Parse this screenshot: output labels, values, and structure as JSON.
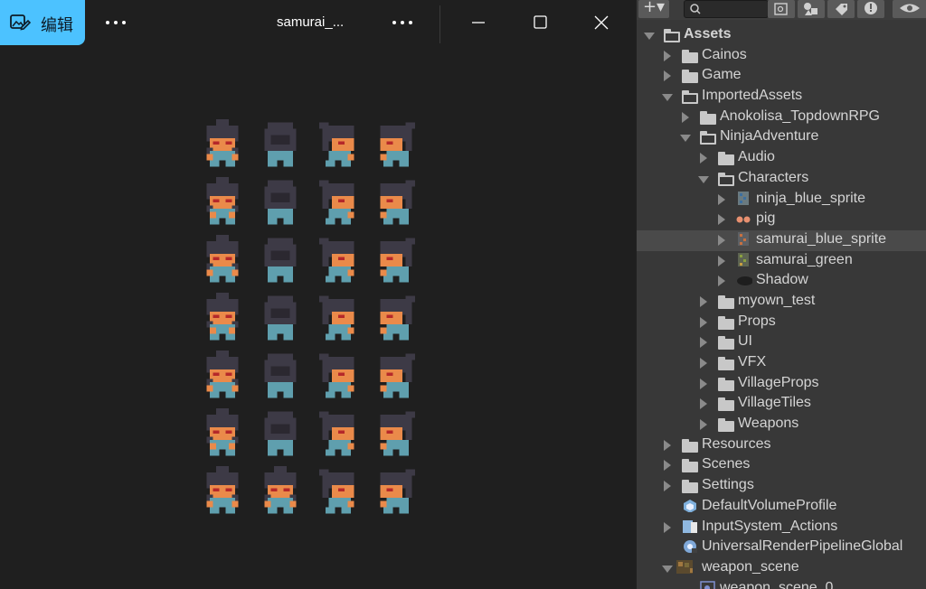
{
  "viewer": {
    "edit_label": "编辑",
    "title": "samurai_...",
    "icons": {
      "edit": "edit-image-icon",
      "more": "more-dots-icon",
      "minimize": "minimize-icon",
      "maximize": "maximize-icon",
      "close": "close-icon"
    },
    "sprite_sheet": {
      "rows": 7,
      "cols": 4,
      "palette": {
        "hair": "#3d3a46",
        "skin": "#ea8a4a",
        "eye": "#b5282a",
        "cloth": "#5f9fae"
      }
    }
  },
  "project": {
    "toolbar": {
      "icons": [
        "add-icon",
        "search-icon",
        "scene-search-icon",
        "filter-type-icon",
        "label-icon",
        "warning-icon",
        "eye-icon"
      ]
    },
    "tree": [
      {
        "label": "Assets",
        "depth": 0,
        "state": "expanded",
        "icon": "folder-open",
        "bold": true
      },
      {
        "label": "Cainos",
        "depth": 1,
        "state": "collapsed",
        "icon": "folder"
      },
      {
        "label": "Game",
        "depth": 1,
        "state": "collapsed",
        "icon": "folder"
      },
      {
        "label": "ImportedAssets",
        "depth": 1,
        "state": "expanded",
        "icon": "folder-open"
      },
      {
        "label": "Anokolisa_TopdownRPG",
        "depth": 2,
        "state": "collapsed",
        "icon": "folder"
      },
      {
        "label": "NinjaAdventure",
        "depth": 2,
        "state": "expanded",
        "icon": "folder-open"
      },
      {
        "label": "Audio",
        "depth": 3,
        "state": "collapsed",
        "icon": "folder"
      },
      {
        "label": "Characters",
        "depth": 3,
        "state": "expanded",
        "icon": "folder-open"
      },
      {
        "label": "ninja_blue_sprite",
        "depth": 4,
        "state": "collapsed",
        "icon": "sprite-blue"
      },
      {
        "label": "pig",
        "depth": 4,
        "state": "collapsed",
        "icon": "sprite-pig"
      },
      {
        "label": "samurai_blue_sprite",
        "depth": 4,
        "state": "collapsed",
        "icon": "sprite-samurai",
        "selected": true
      },
      {
        "label": "samurai_green",
        "depth": 4,
        "state": "collapsed",
        "icon": "sprite-green"
      },
      {
        "label": "Shadow",
        "depth": 4,
        "state": "collapsed",
        "icon": "shadow"
      },
      {
        "label": "myown_test",
        "depth": 3,
        "state": "collapsed",
        "icon": "folder"
      },
      {
        "label": "Props",
        "depth": 3,
        "state": "collapsed",
        "icon": "folder"
      },
      {
        "label": "UI",
        "depth": 3,
        "state": "collapsed",
        "icon": "folder"
      },
      {
        "label": "VFX",
        "depth": 3,
        "state": "collapsed",
        "icon": "folder"
      },
      {
        "label": "VillageProps",
        "depth": 3,
        "state": "collapsed",
        "icon": "folder"
      },
      {
        "label": "VillageTiles",
        "depth": 3,
        "state": "collapsed",
        "icon": "folder"
      },
      {
        "label": "Weapons",
        "depth": 3,
        "state": "collapsed",
        "icon": "folder"
      },
      {
        "label": "Resources",
        "depth": 1,
        "state": "collapsed",
        "icon": "folder"
      },
      {
        "label": "Scenes",
        "depth": 1,
        "state": "collapsed",
        "icon": "folder"
      },
      {
        "label": "Settings",
        "depth": 1,
        "state": "collapsed",
        "icon": "folder"
      },
      {
        "label": "DefaultVolumeProfile",
        "depth": 1,
        "state": "none",
        "icon": "volume-profile"
      },
      {
        "label": "InputSystem_Actions",
        "depth": 1,
        "state": "collapsed",
        "icon": "input-actions"
      },
      {
        "label": "UniversalRenderPipelineGlobal",
        "depth": 1,
        "state": "none",
        "icon": "render-pipeline"
      },
      {
        "label": "weapon_scene",
        "depth": 1,
        "state": "expanded",
        "icon": "scene-thumb"
      },
      {
        "label": "weapon_scene_0",
        "depth": 2,
        "state": "none",
        "icon": "sprite-piece"
      }
    ]
  }
}
